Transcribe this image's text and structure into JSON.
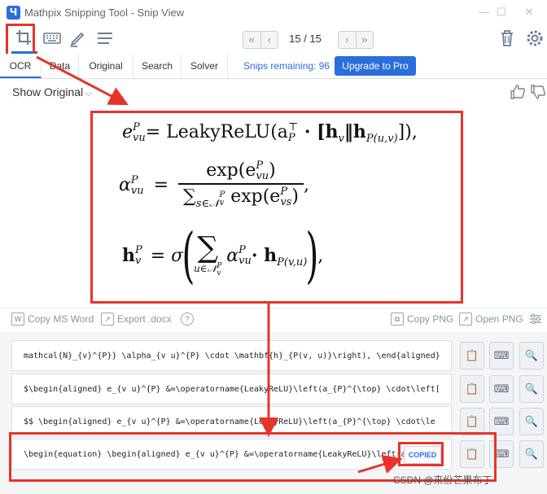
{
  "window": {
    "app_icon": "mathpix-logo",
    "title": "Mathpix Snipping Tool - Snip View",
    "controls": [
      "minimize-icon",
      "maximize-icon",
      "close-icon"
    ]
  },
  "toolbar": {
    "tools": [
      "crop-icon",
      "keyboard-icon",
      "pen-icon",
      "menu-icon"
    ],
    "pager": {
      "prev_first": "«",
      "prev": "‹",
      "text": "15 / 15",
      "next": "›",
      "next_last": "»"
    },
    "right_icons": [
      "trash-icon",
      "gear-icon"
    ]
  },
  "tabs": [
    "OCR",
    "Data",
    "Original",
    "Search",
    "Solver"
  ],
  "active_tab": "OCR",
  "snips_remaining": "Snips remaining: 96",
  "upgrade_label": "Upgrade to Pro",
  "show_original": "Show Original",
  "show_original_chevron": "⌵",
  "feedback_icons": [
    "thumbs-up-icon",
    "thumbs-down-icon"
  ],
  "equation": {
    "line1": {
      "lhs": "e",
      "lhs_sub": "vu",
      "lhs_sup": "P",
      "rhs": "= LeakyReLU(a",
      "rhs_sup": "⊤",
      "rhs_sub": "P",
      "rhs_rest": " · [h",
      "h_sub": "v",
      "mid": "‖h",
      "mid_sub": "P(u,v)",
      "tail": "]),"
    },
    "line2": {
      "lhs": "α",
      "lhs_sub": "vu",
      "lhs_sup": "P",
      "eq": "=",
      "num": "exp(e",
      "num_sub": "vu",
      "num_sup": "P",
      "num_close": ")",
      "den": "∑",
      "den_sub": "s∈𝒩",
      "den_sub_sub": "v",
      "den_sub_sup": "P",
      "den_rest": " exp(e",
      "den_rest_sub": "vs",
      "den_rest_sup": "P",
      "den_close": ")",
      "tail": ","
    },
    "line3": {
      "lhs": "h",
      "lhs_sub": "v",
      "lhs_sup": "P",
      "eq": "= σ",
      "sum": "∑",
      "sum_sub": "u∈𝒩",
      "sum_sub_sub": "v",
      "sum_sub_sup": "P",
      "body": "α",
      "body_sub": "vu",
      "body_sup": "P",
      "dot": " · h",
      "h_sub": "P(v,u)",
      "tail": ","
    }
  },
  "actions": {
    "copy_word": "Copy MS Word",
    "export_docx": "Export .docx",
    "help": "?",
    "copy_png": "Copy PNG",
    "open_png": "Open PNG",
    "settings_icon": "sliders-icon"
  },
  "results": [
    "mathcal{N}_{v}^{P}} \\alpha_{v u}^{P} \\cdot \\mathbf{h}_{P(v, u)}\\right), \\end{aligned}",
    "$\\begin{aligned} e_{v u}^{P} &=\\operatorname{LeakyReLU}\\left(a_{P}^{\\top} \\cdot\\left[",
    "$$  \\begin{aligned} e_{v u}^{P} &=\\operatorname{LeakyReLU}\\left(a_{P}^{\\top} \\cdot\\le",
    "\\begin{equation}  \\begin{aligned} e_{v u}^{P} &=\\operatorname{LeakyReLU}\\left(a"
  ],
  "row_buttons": [
    "copy-icon",
    "keyboard-icon",
    "search-icon"
  ],
  "copied_badge": "COPIED",
  "watermark": "CSDN @来份芒果布丁"
}
